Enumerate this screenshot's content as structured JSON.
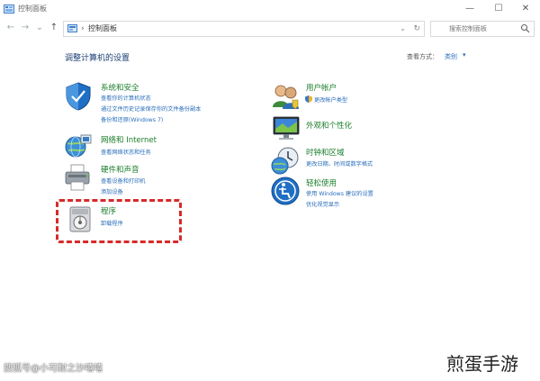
{
  "window": {
    "title": "控制面板",
    "buttons": {
      "minimize": "—",
      "maximize": "☐",
      "close": "✕"
    }
  },
  "address_bar": {
    "back": "←",
    "forward": "→",
    "recent": "⌄",
    "up": "↑",
    "separator": "›",
    "path": "控制面板",
    "dropdown": "⌄",
    "refresh": "↻"
  },
  "search": {
    "placeholder": "搜索控制面板"
  },
  "main": {
    "heading": "调整计算机的设置",
    "view_by_label": "查看方式：",
    "view_by_value": "类别",
    "view_by_caret": "▾"
  },
  "categories": [
    {
      "title": "系统和安全",
      "links": [
        "查看你的计算机状态",
        "通过文件历史记录保存你的文件备份副本",
        "备份和还原(Windows 7)"
      ],
      "icon": "shield-icon"
    },
    {
      "title": "网络和 Internet",
      "links": [
        "查看网络状态和任务"
      ],
      "icon": "network-globe-icon"
    },
    {
      "title": "硬件和声音",
      "links": [
        "查看设备和打印机",
        "添加设备"
      ],
      "icon": "printer-icon"
    },
    {
      "title": "程序",
      "links": [
        "卸载程序"
      ],
      "icon": "programs-icon"
    },
    {
      "title": "用户帐户",
      "links": [
        "更改帐户类型"
      ],
      "icon": "users-icon"
    },
    {
      "title": "外观和个性化",
      "links": [],
      "icon": "monitor-icon"
    },
    {
      "title": "时钟和区域",
      "links": [
        "更改日期、时间或数字格式"
      ],
      "icon": "clock-globe-icon"
    },
    {
      "title": "轻松使用",
      "links": [
        "使用 Windows 建议的设置",
        "优化视觉显示"
      ],
      "icon": "accessibility-icon"
    }
  ],
  "watermarks": {
    "left": "搜狐号@小可耐之沙嘻嘻",
    "right": "煎蛋手游"
  },
  "colors": {
    "category_title": "#1a7d2a",
    "link": "#2a6ebb",
    "heading": "#1a3f73",
    "highlight_box": "#d62a2a"
  }
}
